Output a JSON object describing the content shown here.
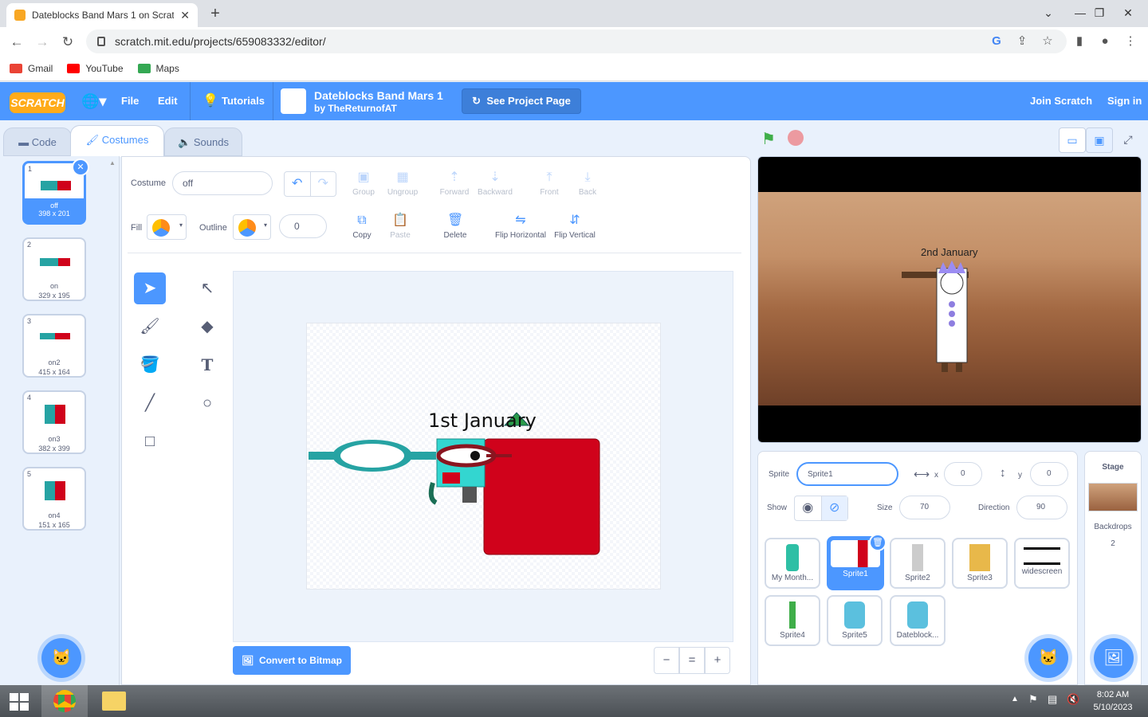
{
  "browser": {
    "tab_title": "Dateblocks Band Mars 1 on Scrat",
    "url": "scratch.mit.edu/projects/659083332/editor/",
    "bookmarks": [
      {
        "label": "Gmail",
        "color": "#ea4335"
      },
      {
        "label": "YouTube",
        "color": "#ff0000"
      },
      {
        "label": "Maps",
        "color": "#34a853"
      }
    ]
  },
  "menu": {
    "logo": "SCRATCH",
    "file": "File",
    "edit": "Edit",
    "tutorials": "Tutorials",
    "project_title": "Dateblocks Band Mars 1",
    "project_author": "by TheReturnofAT",
    "see_project": "See Project Page",
    "join": "Join Scratch",
    "signin": "Sign in"
  },
  "tabs": {
    "code": "Code",
    "costumes": "Costumes",
    "sounds": "Sounds"
  },
  "costumes": [
    {
      "num": "1",
      "name": "off",
      "size": "398 x 201"
    },
    {
      "num": "2",
      "name": "on",
      "size": "329 x 195"
    },
    {
      "num": "3",
      "name": "on2",
      "size": "415 x 164"
    },
    {
      "num": "4",
      "name": "on3",
      "size": "382 x 399"
    },
    {
      "num": "5",
      "name": "on4",
      "size": "151 x 165"
    }
  ],
  "toolbar": {
    "costume_label": "Costume",
    "costume_value": "off",
    "fill_label": "Fill",
    "outline_label": "Outline",
    "outline_width": "0",
    "group": "Group",
    "ungroup": "Ungroup",
    "forward": "Forward",
    "backward": "Backward",
    "front": "Front",
    "back": "Back",
    "copy": "Copy",
    "paste": "Paste",
    "delete": "Delete",
    "flip_h": "Flip Horizontal",
    "flip_v": "Flip Vertical"
  },
  "canvas": {
    "text": "1st January",
    "convert": "Convert to Bitmap",
    "zoom_out": "−",
    "zoom_reset": "=",
    "zoom_in": "+"
  },
  "stage": {
    "text": "2nd January"
  },
  "sprite_info": {
    "sprite_label": "Sprite",
    "sprite_name": "Sprite1",
    "x_label": "x",
    "x": "0",
    "y_label": "y",
    "y": "0",
    "show_label": "Show",
    "size_label": "Size",
    "size": "70",
    "direction_label": "Direction",
    "direction": "90"
  },
  "sprites": [
    {
      "name": "My Month...",
      "color": "#2ebfa5"
    },
    {
      "name": "Sprite1",
      "color": "#d0021b"
    },
    {
      "name": "Sprite2",
      "color": "#cccccc"
    },
    {
      "name": "Sprite3",
      "color": "#e8b84a"
    },
    {
      "name": "widescreen",
      "color": "#000000"
    },
    {
      "name": "Sprite4",
      "color": "#3fae49"
    },
    {
      "name": "Sprite5",
      "color": "#5bc0de"
    },
    {
      "name": "Dateblock...",
      "color": "#5bc0de"
    }
  ],
  "stage_pane": {
    "title": "Stage",
    "backdrops_label": "Backdrops",
    "backdrops_count": "2"
  },
  "taskbar": {
    "time": "8:02 AM",
    "date": "5/10/2023"
  }
}
